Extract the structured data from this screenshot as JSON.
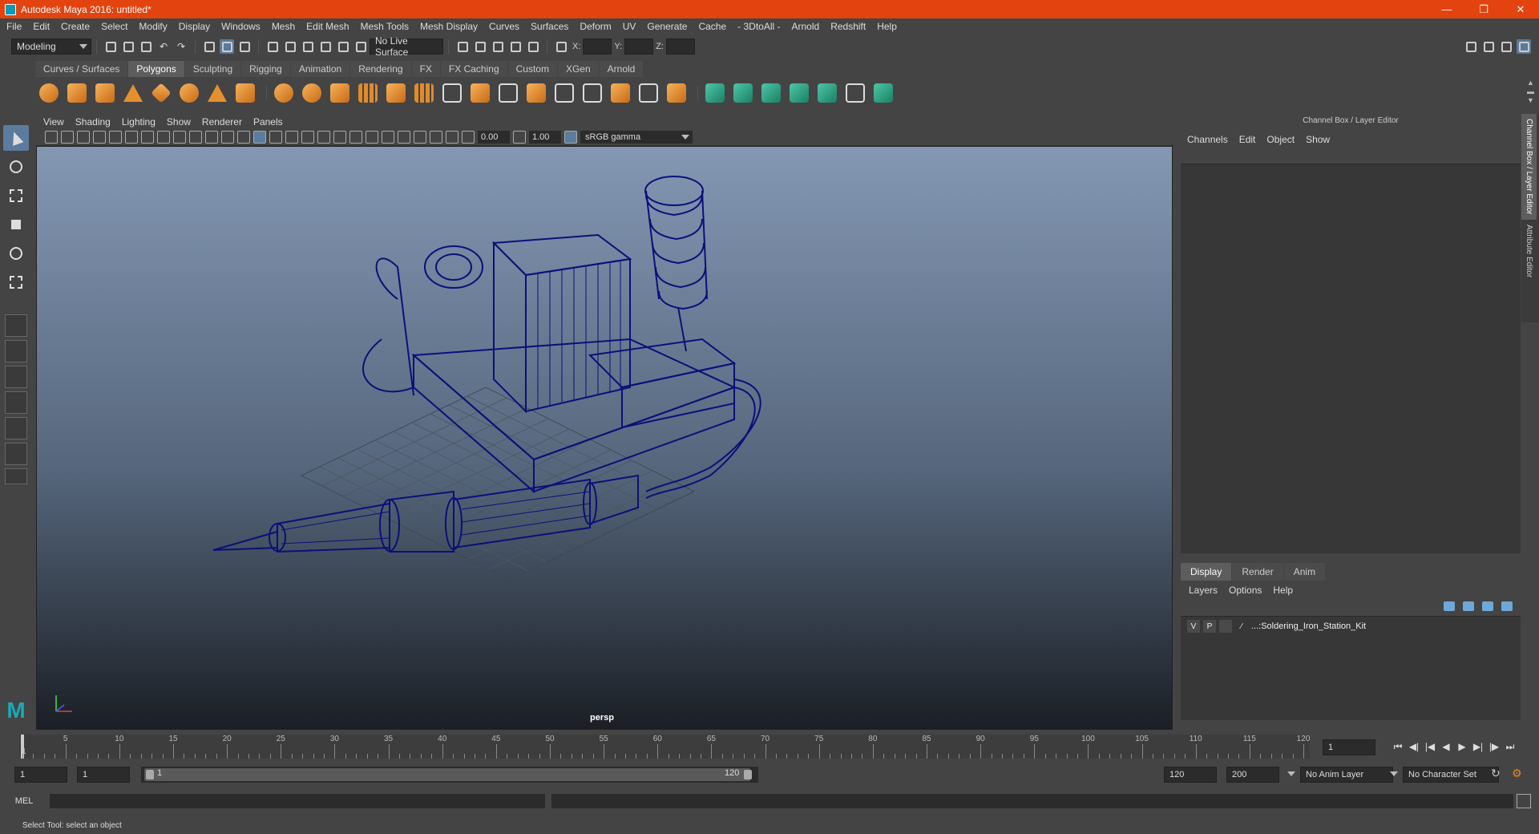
{
  "window": {
    "title": "Autodesk Maya 2016: untitled*"
  },
  "menubar": [
    "File",
    "Edit",
    "Create",
    "Select",
    "Modify",
    "Display",
    "Windows",
    "Mesh",
    "Edit Mesh",
    "Mesh Tools",
    "Mesh Display",
    "Curves",
    "Surfaces",
    "Deform",
    "UV",
    "Generate",
    "Cache",
    "- 3DtoAll -",
    "Arnold",
    "Redshift",
    "Help"
  ],
  "statusline": {
    "menu_set": "Modeling",
    "live_surface": "No Live Surface",
    "coord_labels": [
      "X:",
      "Y:",
      "Z:"
    ]
  },
  "shelf": {
    "tabs": [
      "Curves / Surfaces",
      "Polygons",
      "Sculpting",
      "Rigging",
      "Animation",
      "Rendering",
      "FX",
      "FX Caching",
      "Custom",
      "XGen",
      "Arnold"
    ],
    "active_tab": "Polygons"
  },
  "panel": {
    "menu": [
      "View",
      "Shading",
      "Lighting",
      "Show",
      "Renderer",
      "Panels"
    ],
    "exposure": "0.00",
    "gamma": "1.00",
    "color_space": "sRGB gamma",
    "camera": "persp"
  },
  "channel_box": {
    "title": "Channel Box / Layer Editor",
    "menu": [
      "Channels",
      "Edit",
      "Object",
      "Show"
    ],
    "layer_tabs": [
      "Display",
      "Render",
      "Anim"
    ],
    "layer_menu": [
      "Layers",
      "Options",
      "Help"
    ],
    "layer": {
      "visible": "V",
      "playback": "P",
      "name": "...:Soldering_Iron_Station_Kit"
    },
    "side_tabs": [
      "Channel Box / Layer Editor",
      "Attribute Editor"
    ]
  },
  "timeline": {
    "ticks": [
      5,
      10,
      15,
      20,
      25,
      30,
      35,
      40,
      45,
      50,
      55,
      60,
      65,
      70,
      75,
      80,
      85,
      90,
      95,
      100,
      105,
      110,
      115,
      120
    ],
    "start_label": "1",
    "current_frame": "1"
  },
  "range": {
    "start": "1",
    "playback_start": "1",
    "slider_start": "1",
    "slider_end": "120",
    "playback_end": "120",
    "end": "200",
    "anim_layer": "No Anim Layer",
    "character_set": "No Character Set"
  },
  "cmdline": {
    "lang": "MEL"
  },
  "helpline": {
    "text": "Select Tool: select an object"
  },
  "colors": {
    "titlebar": "#e3430f",
    "wireframe": "#0b0f7a",
    "accent": "#5b7c9f"
  }
}
